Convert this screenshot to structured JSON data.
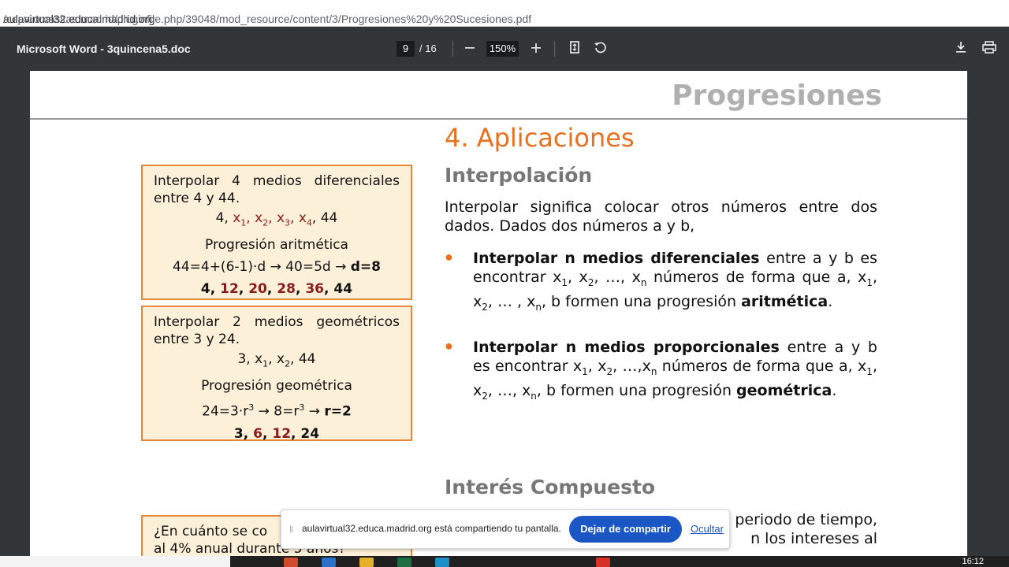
{
  "browser": {
    "url_domain": "aulavirtual32.educa.madrid.org",
    "url_path": "/cepa.orcasitas.madrid/pluginfile.php/39048/mod_resource/content/3/Progresiones%20y%20Sucesiones.pdf"
  },
  "viewer": {
    "title": "Microsoft Word - 3quincena5.doc",
    "page_current": "9",
    "page_total": "/ 16",
    "zoom": "150%",
    "zoom_out_icon": "minus-icon",
    "zoom_in_icon": "plus-icon",
    "fit_icon": "fit-page-icon",
    "rotate_icon": "rotate-icon",
    "download_icon": "download-icon",
    "print_icon": "print-icon"
  },
  "doc": {
    "header": "Progresiones",
    "section_title": "4. Aplicaciones",
    "interp_heading": "Interpolación",
    "interp_paragraph": "Interpolar significa colocar otros números entre dos dados. Dados dos números a y b,",
    "bullet1_bold": "Interpolar n medios diferenciales",
    "bullet1_a": " entre a y b es encontrar x",
    "bullet1_tail": "aritmética",
    "bullet2_bold": "Interpolar n medios proporcionales",
    "bullet2_tail": "geométrica",
    "interes_heading": "Interés Compuesto",
    "interes_partial_right1": "periodo de tiempo,",
    "interes_partial_right2": "n los intereses al",
    "box1": {
      "intro": "Interpolar 4 medios diferenciales entre 4 y 44.",
      "kind": "Progresión aritmética",
      "result_values": [
        "4",
        "12",
        "20",
        "28",
        "36",
        "44"
      ]
    },
    "box2": {
      "intro": "Interpolar 2 medios geométricos entre 3 y 24.",
      "kind": "Progresión geométrica",
      "result_values": [
        "3",
        "6",
        "12",
        "24"
      ]
    },
    "box3_partial": "¿En cuánto se co",
    "box3_partial2": "al 4% anual durante 5 años?"
  },
  "share_bar": {
    "text": "aulavirtual32.educa.madrid.org está compartiendo tu pantalla.",
    "stop_label": "Dejar de compartir",
    "hide_label": "Ocultar"
  },
  "taskbar": {
    "clock": "16:12"
  },
  "colors": {
    "accent_orange": "#e8701f",
    "box_border": "#e8873a",
    "box_fill": "#fdf0d8",
    "dark_red": "#8b1a1a",
    "share_button": "#1a56c4"
  }
}
